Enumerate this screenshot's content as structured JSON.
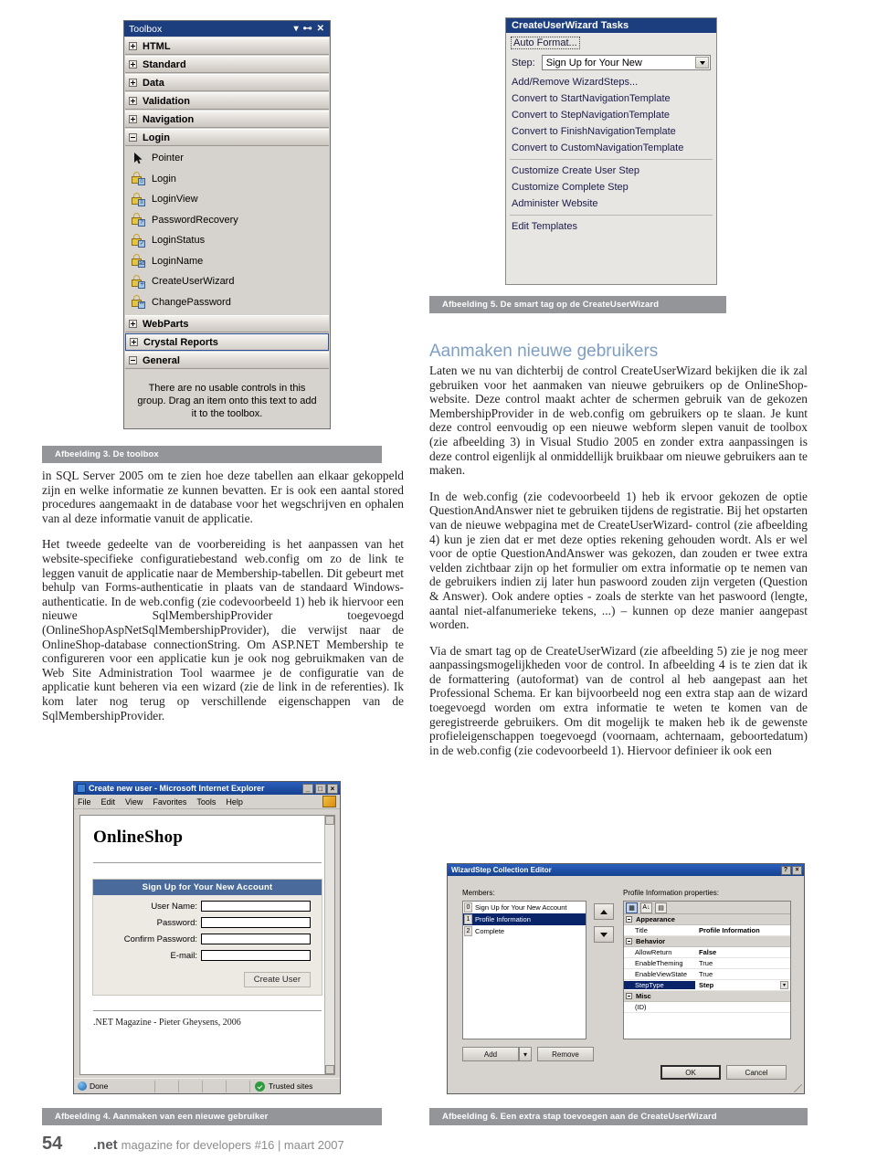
{
  "toolbox": {
    "title": "Toolbox",
    "window_buttons": [
      "chevron-down",
      "pin",
      "close"
    ],
    "categories": [
      {
        "label": "HTML",
        "state": "collapsed"
      },
      {
        "label": "Standard",
        "state": "collapsed"
      },
      {
        "label": "Data",
        "state": "collapsed"
      },
      {
        "label": "Validation",
        "state": "collapsed"
      },
      {
        "label": "Navigation",
        "state": "collapsed"
      },
      {
        "label": "Login",
        "state": "expanded"
      }
    ],
    "login_items": [
      {
        "label": "Pointer",
        "icon": "pointer-icon"
      },
      {
        "label": "Login",
        "icon": "login-icon"
      },
      {
        "label": "LoginView",
        "icon": "loginview-icon"
      },
      {
        "label": "PasswordRecovery",
        "icon": "passwordrecovery-icon"
      },
      {
        "label": "LoginStatus",
        "icon": "loginstatus-icon"
      },
      {
        "label": "LoginName",
        "icon": "loginname-icon"
      },
      {
        "label": "CreateUserWizard",
        "icon": "createuserwizard-icon"
      },
      {
        "label": "ChangePassword",
        "icon": "changepassword-icon"
      }
    ],
    "categories_bottom": [
      {
        "label": "WebParts",
        "state": "collapsed",
        "selected": false
      },
      {
        "label": "Crystal Reports",
        "state": "collapsed",
        "selected": true
      },
      {
        "label": "General",
        "state": "expanded",
        "selected": false
      }
    ],
    "empty_note": "There are no usable controls in this group. Drag an item onto this text to add it to the toolbox."
  },
  "cuw_tasks": {
    "title": "CreateUserWizard Tasks",
    "auto_format": "Auto Format...",
    "step_label": "Step:",
    "step_value": "Sign Up for Your New",
    "links_group1": [
      "Add/Remove WizardSteps...",
      "Convert to StartNavigationTemplate",
      "Convert to StepNavigationTemplate",
      "Convert to FinishNavigationTemplate",
      "Convert to CustomNavigationTemplate"
    ],
    "links_group2": [
      "Customize Create User Step",
      "Customize Complete Step",
      "Administer Website"
    ],
    "links_group3": [
      "Edit Templates"
    ]
  },
  "captions": {
    "fig3": "Afbeelding 3. De toolbox",
    "fig4": "Afbeelding 4. Aanmaken van een nieuwe gebruiker",
    "fig5": "Afbeelding 5. De smart tag op de CreateUserWizard",
    "fig6": "Afbeelding 6. Een extra stap toevoegen aan de CreateUserWizard"
  },
  "left_column": {
    "paragraphs": [
      "in SQL Server 2005 om te zien hoe deze tabellen aan elkaar gekoppeld zijn en welke informatie ze kunnen bevatten. Er is ook een aantal stored procedures aangemaakt in de database voor het wegschrijven en ophalen van al deze informatie vanuit de applicatie.",
      "Het tweede gedeelte van de voorbereiding is het aanpassen van het website-specifieke configuratiebestand web.config om zo de link te leggen vanuit de applicatie naar de Membership-tabellen. Dit gebeurt met behulp van Forms-authenticatie in plaats van de standaard Windows-authenticatie. In de web.config (zie codevoorbeeld 1) heb ik hiervoor een nieuwe SqlMembershipProvider toegevoegd (OnlineShopAspNetSqlMembershipProvider), die verwijst naar de OnlineShop-database connectionString. Om ASP.NET Membership te configureren voor een applicatie kun je ook nog gebruikmaken van de Web Site Administration Tool waarmee je de configuratie van de applicatie kunt beheren via een wizard (zie de link in de referenties). Ik kom later nog terug op verschillende eigenschappen van de SqlMembershipProvider."
    ]
  },
  "right_column": {
    "heading": "Aanmaken nieuwe gebruikers",
    "paragraphs": [
      "Laten we nu van dichterbij de control CreateUserWizard bekijken die ik zal gebruiken voor het aanmaken van nieuwe gebruikers op de OnlineShop-website. Deze control maakt achter de schermen gebruik van de gekozen MembershipProvider in de web.config om gebruikers op te slaan. Je kunt deze control eenvoudig op een nieuwe webform slepen vanuit de toolbox (zie afbeelding 3) in Visual Studio 2005 en zonder extra aanpassingen is deze control eigenlijk al onmiddellijk bruikbaar om nieuwe gebruikers aan te maken.",
      "In de web.config (zie codevoorbeeld 1) heb ik ervoor gekozen de optie QuestionAndAnswer niet te gebruiken tijdens de registratie. Bij het opstarten van de nieuwe webpagina met de CreateUserWizard- control (zie afbeelding 4) kun je zien dat er met deze opties rekening gehouden wordt. Als er wel voor de optie QuestionAndAnswer was gekozen, dan zouden er twee extra velden zichtbaar zijn op het formulier om extra informatie op te nemen van de gebruikers indien zij later hun paswoord zouden zijn vergeten (Question & Answer). Ook andere opties - zoals de sterkte van het paswoord (lengte, aantal niet-alfanumerieke tekens, ...) – kunnen op deze manier aangepast worden.",
      "Via de smart tag op de CreateUserWizard (zie afbeelding 5) zie je nog meer aanpassingsmogelijkheden voor de control. In afbeelding 4 is te zien dat ik de formattering (autoformat) van de control al heb aangepast aan het Professional Schema. Er kan bijvoorbeeld nog een extra stap aan de wizard toegevoegd worden om extra informatie te weten te komen van de geregistreerde gebruikers. Om dit mogelijk te maken heb ik de gewenste profieleigenschappen toegevoegd (voornaam, achternaam, geboortedatum) in de web.config (zie codevoorbeeld 1). Hiervoor definieer ik ook een"
    ]
  },
  "ie_window": {
    "title": "Create new user - Microsoft Internet Explorer",
    "window_buttons": [
      "_",
      "□",
      "×"
    ],
    "menu": [
      "File",
      "Edit",
      "View",
      "Favorites",
      "Tools",
      "Help"
    ],
    "page_title": "OnlineShop",
    "wizard_header": "Sign Up for Your New Account",
    "fields": [
      {
        "label": "User Name:",
        "value": ""
      },
      {
        "label": "Password:",
        "value": ""
      },
      {
        "label": "Confirm Password:",
        "value": ""
      },
      {
        "label": "E-mail:",
        "value": ""
      }
    ],
    "submit_button": "Create User",
    "page_footer": ".NET Magazine - Pieter Gheysens, 2006",
    "status_left": "Done",
    "status_zone": "Trusted sites"
  },
  "wizardstep_editor": {
    "title": "WizardStep Collection Editor",
    "window_buttons": [
      "?",
      "×"
    ],
    "members_label": "Members:",
    "members": [
      {
        "index": "0",
        "label": "Sign Up for Your New Account",
        "selected": false
      },
      {
        "index": "1",
        "label": "Profile Information",
        "selected": true
      },
      {
        "index": "2",
        "label": "Complete",
        "selected": false
      }
    ],
    "properties_label": "Profile Information properties:",
    "property_groups": [
      {
        "name": "Appearance",
        "rows": [
          {
            "key": "Title",
            "value": "Profile Information",
            "bold": true,
            "selected": false
          }
        ]
      },
      {
        "name": "Behavior",
        "rows": [
          {
            "key": "AllowReturn",
            "value": "False",
            "bold": true,
            "selected": false
          },
          {
            "key": "EnableTheming",
            "value": "True",
            "bold": false,
            "selected": false
          },
          {
            "key": "EnableViewState",
            "value": "True",
            "bold": false,
            "selected": false
          },
          {
            "key": "StepType",
            "value": "Step",
            "bold": true,
            "selected": true
          }
        ]
      },
      {
        "name": "Misc",
        "rows": [
          {
            "key": "(ID)",
            "value": "",
            "bold": false,
            "selected": false
          }
        ]
      }
    ],
    "add_button": "Add",
    "remove_button": "Remove",
    "ok_button": "OK",
    "cancel_button": "Cancel"
  },
  "footer": {
    "page_number": "54",
    "brand": ".net",
    "rest": "magazine for developers #16 | maart 2007"
  },
  "colors": {
    "caption_bar": "#939598",
    "heading": "#7e9ec4",
    "titlebar": "#1d3e7e",
    "wizard_header": "#4a6a9c",
    "selection": "#0a246a"
  }
}
